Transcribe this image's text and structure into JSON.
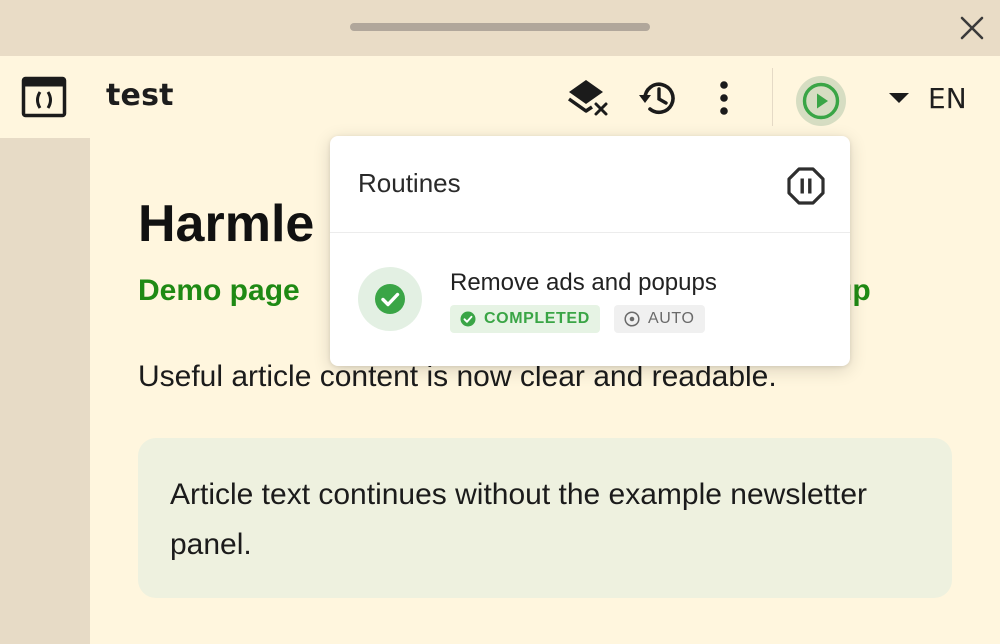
{
  "window": {
    "title": "test"
  },
  "toolbar": {
    "language": "EN",
    "icons": {
      "app": "code-panel-icon",
      "layers_off": "layers-clear-icon",
      "history": "history-icon",
      "more": "more-vert-icon",
      "run": "play-circle-icon",
      "language_dropdown": "caret-down-icon"
    }
  },
  "page": {
    "heading": "Harmle",
    "subtitle_start": "Demo page",
    "subtitle_end": "up",
    "body_text": "Useful article content is now clear and readable.",
    "article_text": "Article text continues without the example newsletter panel."
  },
  "routines_popup": {
    "title": "Routines",
    "routines": [
      {
        "name": "Remove ads and popups",
        "status": "COMPLETED",
        "mode": "AUTO"
      }
    ]
  },
  "colors": {
    "accent_green": "#3aa546",
    "subtitle_green": "#1f8a14",
    "background": "#fff6de",
    "sidebar": "#e7dbc6"
  }
}
